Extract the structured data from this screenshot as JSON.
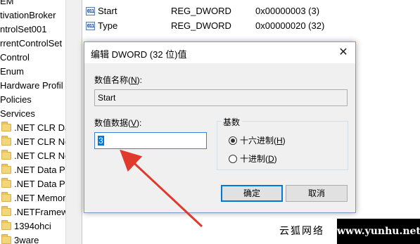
{
  "tree": {
    "items": [
      {
        "label": "EM",
        "folder": false
      },
      {
        "label": "tivationBroker",
        "folder": false
      },
      {
        "label": "ntrolSet001",
        "folder": false
      },
      {
        "label": "rrentControlSet",
        "folder": false
      },
      {
        "label": "Control",
        "folder": false
      },
      {
        "label": "Enum",
        "folder": false
      },
      {
        "label": "Hardware Profil",
        "folder": false
      },
      {
        "label": "Policies",
        "folder": false
      },
      {
        "label": "Services",
        "folder": false
      },
      {
        "label": ".NET CLR Dat",
        "folder": true
      },
      {
        "label": ".NET CLR Ne",
        "folder": true
      },
      {
        "label": ".NET CLR Ne",
        "folder": true
      },
      {
        "label": ".NET Data Pr",
        "folder": true
      },
      {
        "label": ".NET Data Pr",
        "folder": true
      },
      {
        "label": ".NET Memor",
        "folder": true
      },
      {
        "label": ".NETFramewo",
        "folder": true
      },
      {
        "label": "1394ohci",
        "folder": true
      },
      {
        "label": "3ware",
        "folder": true
      }
    ]
  },
  "values": [
    {
      "icon": "011",
      "name": "Start",
      "type": "REG_DWORD",
      "data": "0x00000003 (3)"
    },
    {
      "icon": "011",
      "name": "Type",
      "type": "REG_DWORD",
      "data": "0x00000020 (32)"
    }
  ],
  "dialog": {
    "title": "编辑 DWORD (32 位)值",
    "close_glyph": "✕",
    "name_label": "数值名称(",
    "name_label_key": "N",
    "name_label_end": "):",
    "name_value": "Start",
    "data_label": "数值数据(",
    "data_label_key": "V",
    "data_label_end": "):",
    "data_value": "3",
    "base_label": "基数",
    "hex_label": "十六进制(",
    "hex_key": "H",
    "hex_end": ")",
    "dec_label": "十进制(",
    "dec_key": "D",
    "dec_end": ")",
    "selected_base": "hex",
    "ok_label": "确定",
    "cancel_label": "取消"
  },
  "watermark": {
    "left_text": "云狐网络",
    "right_text": "www.yunhu.net"
  },
  "colors": {
    "arrow": "#e03a2e",
    "accent": "#0078d7"
  }
}
